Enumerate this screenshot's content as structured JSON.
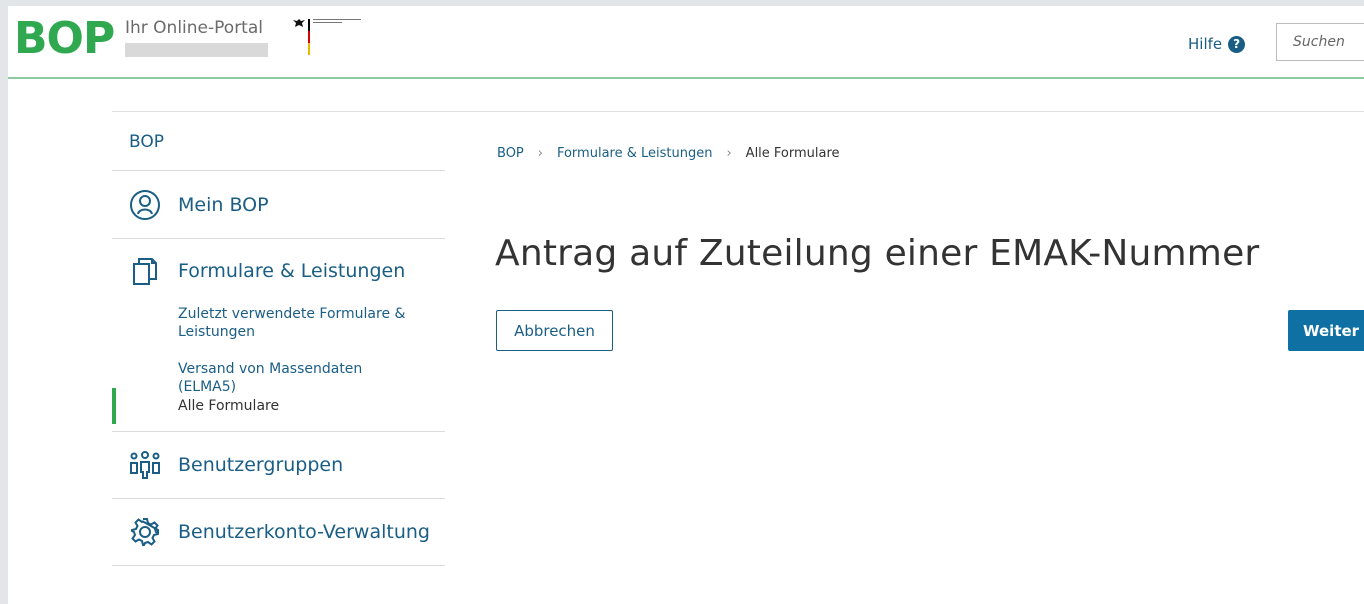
{
  "header": {
    "logo": "BOP",
    "portal_title": "Ihr Online-Portal",
    "ministry_logo": "bundesministerium-emblem",
    "help_label": "Hilfe",
    "help_icon": "question-circle-icon",
    "search_placeholder": "Suchen"
  },
  "sidebar": {
    "root_label": "BOP",
    "items": [
      {
        "label": "Mein BOP",
        "icon": "user-circle-icon"
      },
      {
        "label": "Formulare & Leistungen",
        "icon": "documents-icon"
      },
      {
        "label": "Benutzergruppen",
        "icon": "users-group-icon"
      },
      {
        "label": "Benutzerkonto-Verwaltung",
        "icon": "gear-icon"
      }
    ],
    "subitems": [
      {
        "label": "Zuletzt verwendete Formulare & Leistungen"
      },
      {
        "label": "Versand von Massendaten (ELMA5)"
      },
      {
        "label": "Alle Formulare",
        "active": true
      }
    ]
  },
  "breadcrumb": [
    "BOP",
    "Formulare & Leistungen",
    "Alle Formulare"
  ],
  "main": {
    "title": "Antrag auf Zuteilung einer EMAK-Nummer",
    "cancel_label": "Abbrechen",
    "next_label": "Weiter"
  },
  "colors": {
    "brand_green": "#2fa84f",
    "link_blue": "#1a5e85",
    "primary_button": "#0f71a3"
  }
}
